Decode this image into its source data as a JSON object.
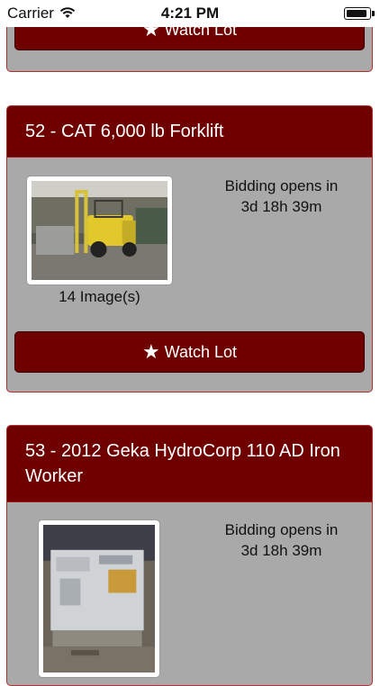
{
  "status": {
    "carrier": "Carrier",
    "time": "4:21 PM"
  },
  "lots": [
    {
      "watch_label": "Watch Lot"
    },
    {
      "title": "52 - CAT 6,000 lb Forklift",
      "bidding_line1": "Bidding opens in",
      "bidding_line2": "3d 18h 39m",
      "image_count": "14 Image(s)",
      "watch_label": "Watch Lot"
    },
    {
      "title": "53 - 2012 Geka HydroCorp 110 AD Iron Worker",
      "bidding_line1": "Bidding opens in",
      "bidding_line2": "3d 18h 39m"
    }
  ],
  "colors": {
    "header_bg": "#6e0000",
    "card_bg": "#a9a9a9",
    "button_bg": "#6e0000"
  }
}
